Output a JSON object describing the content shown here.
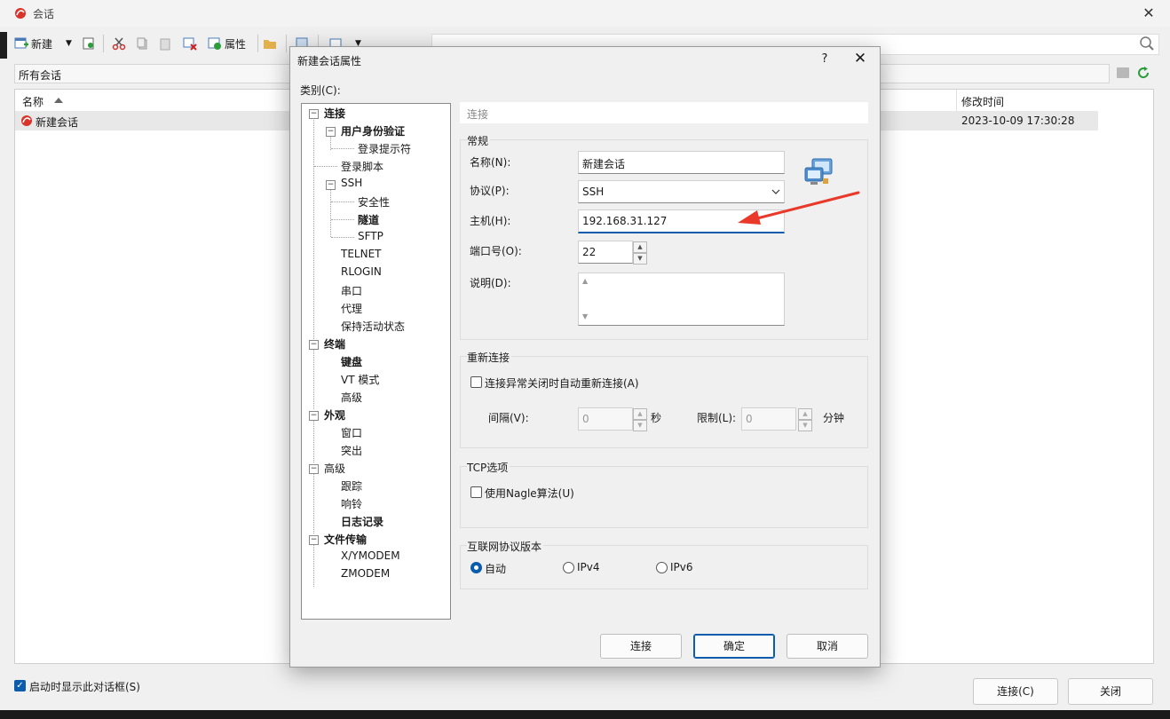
{
  "bg": {
    "title": "会话",
    "toolbar": {
      "new_label": "新建",
      "properties_label": "属性"
    },
    "path": "所有会话",
    "columns": {
      "name": "名称",
      "modified": "修改时间"
    },
    "rows": [
      {
        "name": "新建会话",
        "modified": "2023-10-09 17:30:28"
      }
    ],
    "show_on_start_label": "启动时显示此对话框(S)",
    "connect_label": "连接(C)",
    "close_label": "关闭"
  },
  "dialog": {
    "title": "新建会话属性",
    "help": "?",
    "close": "✕",
    "category_label": "类别(C):",
    "tree": [
      {
        "label": "连接",
        "bold": true
      },
      {
        "label": "用户身份验证",
        "bold": true
      },
      {
        "label": "登录提示符",
        "bold": false
      },
      {
        "label": "登录脚本",
        "bold": false
      },
      {
        "label": "SSH",
        "bold": false
      },
      {
        "label": "安全性",
        "bold": false
      },
      {
        "label": "隧道",
        "bold": true
      },
      {
        "label": "SFTP",
        "bold": false
      },
      {
        "label": "TELNET",
        "bold": false
      },
      {
        "label": "RLOGIN",
        "bold": false
      },
      {
        "label": "串口",
        "bold": false
      },
      {
        "label": "代理",
        "bold": false
      },
      {
        "label": "保持活动状态",
        "bold": false
      },
      {
        "label": "终端",
        "bold": true
      },
      {
        "label": "键盘",
        "bold": true
      },
      {
        "label": "VT 模式",
        "bold": false
      },
      {
        "label": "高级",
        "bold": false
      },
      {
        "label": "外观",
        "bold": true
      },
      {
        "label": "窗口",
        "bold": false
      },
      {
        "label": "突出",
        "bold": false
      },
      {
        "label": "高级",
        "bold": false
      },
      {
        "label": "跟踪",
        "bold": false
      },
      {
        "label": "响铃",
        "bold": false
      },
      {
        "label": "日志记录",
        "bold": true
      },
      {
        "label": "文件传输",
        "bold": true
      },
      {
        "label": "X/YMODEM",
        "bold": false
      },
      {
        "label": "ZMODEM",
        "bold": false
      }
    ],
    "section_header": "连接",
    "general": {
      "title": "常规",
      "name_label": "名称(N):",
      "name_value": "新建会话",
      "protocol_label": "协议(P):",
      "protocol_value": "SSH",
      "host_label": "主机(H):",
      "host_value": "192.168.31.127",
      "port_label": "端口号(O):",
      "port_value": "22",
      "desc_label": "说明(D):",
      "desc_value": ""
    },
    "reconnect": {
      "title": "重新连接",
      "auto_label": "连接异常关闭时自动重新连接(A)",
      "interval_label": "间隔(V):",
      "interval_value": "0",
      "interval_unit": "秒",
      "limit_label": "限制(L):",
      "limit_value": "0",
      "limit_unit": "分钟"
    },
    "tcp": {
      "title": "TCP选项",
      "nagle_label": "使用Nagle算法(U)"
    },
    "ip": {
      "title": "互联网协议版本",
      "options": [
        "自动",
        "IPv4",
        "IPv6"
      ],
      "selected": "自动"
    },
    "buttons": {
      "connect": "连接",
      "ok": "确定",
      "cancel": "取消"
    }
  },
  "colors": {
    "accent": "#0b5cad",
    "arrow": "#e8392a",
    "logo": "#d9342b"
  }
}
